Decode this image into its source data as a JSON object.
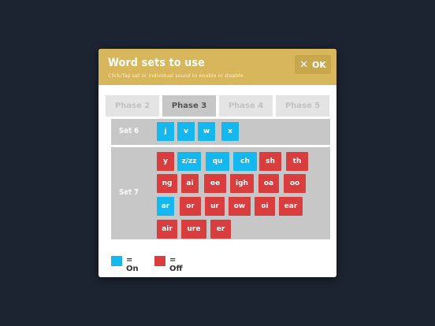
{
  "dialog": {
    "title": "Word sets to use",
    "subtitle": "Click/Tap set or individual sound to enable or disable",
    "ok_label": "OK",
    "ok_icon": "close-x"
  },
  "tabs": [
    {
      "label": "Phase 2",
      "active": false
    },
    {
      "label": "Phase 3",
      "active": true
    },
    {
      "label": "Phase 4",
      "active": false
    },
    {
      "label": "Phase 5",
      "active": false
    }
  ],
  "sets": [
    {
      "label": "Set 6",
      "sounds": [
        {
          "text": "j",
          "on": true
        },
        {
          "text": "v",
          "on": true
        },
        {
          "text": "w",
          "on": true
        },
        {
          "text": "x",
          "on": true
        }
      ]
    },
    {
      "label": "Set 7",
      "sounds": [
        {
          "text": "y",
          "on": false
        },
        {
          "text": "z/zz",
          "on": true
        },
        {
          "text": "qu",
          "on": true
        },
        {
          "text": "ch",
          "on": true
        },
        {
          "text": "sh",
          "on": false
        },
        {
          "text": "th",
          "on": false
        },
        {
          "text": "ng",
          "on": false
        },
        {
          "text": "ai",
          "on": false
        },
        {
          "text": "ee",
          "on": false
        },
        {
          "text": "igh",
          "on": false
        },
        {
          "text": "oa",
          "on": false
        },
        {
          "text": "oo",
          "on": false
        },
        {
          "text": "ar",
          "on": true
        },
        {
          "text": "or",
          "on": false
        },
        {
          "text": "ur",
          "on": false
        },
        {
          "text": "ow",
          "on": false
        },
        {
          "text": "oi",
          "on": false
        },
        {
          "text": "ear",
          "on": false
        },
        {
          "text": "air",
          "on": false
        },
        {
          "text": "ure",
          "on": false
        },
        {
          "text": "er",
          "on": false
        }
      ]
    }
  ],
  "legend": {
    "on_label": "= On",
    "off_label": "= Off",
    "on_color": "#14b7ee",
    "off_color": "#d93d3d"
  }
}
